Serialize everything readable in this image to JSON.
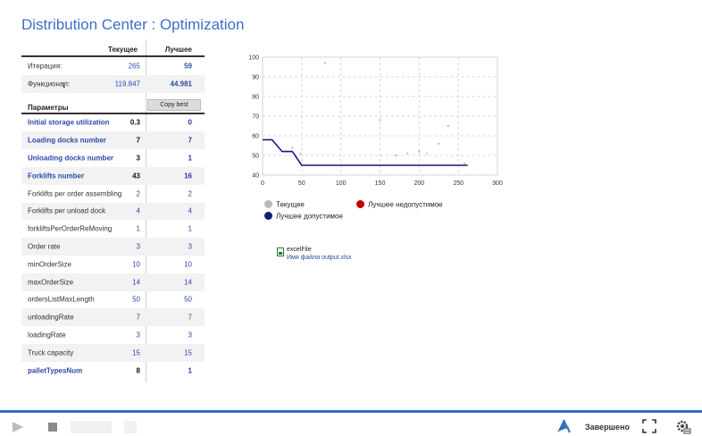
{
  "title": "Distribution Center : Optimization",
  "table": {
    "col_current": "Текущее",
    "col_best": "Лучшее",
    "iteration_label": "Итерация:",
    "iteration_current": "265",
    "iteration_best": "59",
    "function_label": "Функционал:",
    "function_current": "119.847",
    "function_best": "44.981",
    "params_label": "Параметры",
    "copy_best_label": "Copy best",
    "params": [
      {
        "name": "Initial storage utilization",
        "current": "0.3",
        "best": "0"
      },
      {
        "name": "Loading docks number",
        "current": "7",
        "best": "7"
      },
      {
        "name": "Unloading docks number",
        "current": "3",
        "best": "1"
      },
      {
        "name": "Forklifts number",
        "current": "43",
        "best": "16"
      },
      {
        "name": "Forklifts per order assembling",
        "current": "2",
        "best": "2"
      },
      {
        "name": "Forklifts per unload dock",
        "current": "4",
        "best": "4"
      },
      {
        "name": "forkliftsPerOrderReMoving",
        "current": "1",
        "best": "1"
      },
      {
        "name": "Order rate",
        "current": "3",
        "best": "3"
      },
      {
        "name": "minOrderSize",
        "current": "10",
        "best": "10"
      },
      {
        "name": "maxOrderSize",
        "current": "14",
        "best": "14"
      },
      {
        "name": "ordersListMaxLength",
        "current": "50",
        "best": "50"
      },
      {
        "name": "unloadingRate",
        "current": "7",
        "best": "7"
      },
      {
        "name": "loadingRate",
        "current": "3",
        "best": "3"
      },
      {
        "name": "Truck capacity",
        "current": "15",
        "best": "15"
      },
      {
        "name": "palletTypesNum",
        "current": "8",
        "best": "1"
      }
    ]
  },
  "chart_data": {
    "type": "line",
    "xlim": [
      0,
      300
    ],
    "ylim": [
      40,
      100
    ],
    "x_ticks": [
      "0",
      "50",
      "100",
      "150",
      "200",
      "250",
      "300"
    ],
    "y_ticks": [
      "40",
      "50",
      "60",
      "70",
      "80",
      "90",
      "100"
    ],
    "grid": true,
    "legend_position": "bottom",
    "series": [
      {
        "name": "Текущее",
        "color": "#b8b8b8",
        "kind": "scatter",
        "points": [
          [
            38,
            54
          ],
          [
            48,
            51
          ],
          [
            80,
            97
          ],
          [
            150,
            68
          ],
          [
            170,
            50
          ],
          [
            185,
            51
          ],
          [
            200,
            52
          ],
          [
            210,
            51
          ],
          [
            225,
            56
          ],
          [
            237,
            65
          ],
          [
            258,
            46
          ]
        ]
      },
      {
        "name": "Лучшее недопустимое",
        "color": "#c00000",
        "kind": "scatter",
        "points": []
      },
      {
        "name": "Лучшее допустимое",
        "color": "#141a78",
        "kind": "step",
        "points": [
          [
            0,
            58
          ],
          [
            12,
            58
          ],
          [
            25,
            52
          ],
          [
            38,
            52
          ],
          [
            50,
            45
          ],
          [
            100,
            45
          ],
          [
            150,
            45
          ],
          [
            200,
            45
          ],
          [
            262,
            45
          ]
        ]
      }
    ]
  },
  "legend": {
    "current": "Текущее",
    "best_infeasible": "Лучшее недопустимое",
    "best_feasible": "Лучшее допустимое",
    "current_color": "#b8b8b8",
    "best_infeasible_color": "#c00000",
    "best_feasible_color": "#141a78"
  },
  "excel": {
    "name": "excelFile",
    "file_label": "Имя файла output.xlsx"
  },
  "toolbar": {
    "status": "Завершено",
    "accent": "#2f6fbd"
  }
}
